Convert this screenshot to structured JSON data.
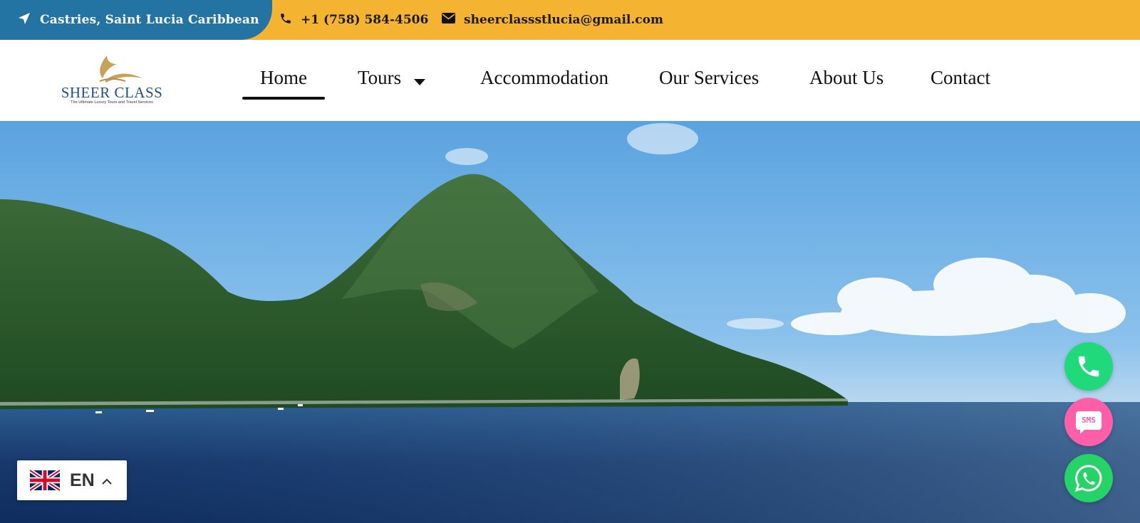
{
  "topbar": {
    "location": "Castries, Saint Lucia Caribbean",
    "phone": "+1 (758) 584-4506",
    "email": "sheerclassstlucia@gmail.com",
    "location_icon": "location-arrow-icon",
    "phone_icon": "phone-icon",
    "email_icon": "envelope-icon",
    "colors": {
      "bar": "#f4b330",
      "location_bg": "#2373a3"
    }
  },
  "logo": {
    "brand": "SHEER CLASS",
    "tagline": "The Ultimate Luxury Tours and Travel Services"
  },
  "nav": {
    "items": [
      {
        "label": "Home",
        "active": true
      },
      {
        "label": "Tours",
        "has_dropdown": true
      },
      {
        "label": "Accommodation"
      },
      {
        "label": "Our Services"
      },
      {
        "label": "About Us"
      },
      {
        "label": "Contact"
      }
    ]
  },
  "floating_buttons": {
    "phone_icon": "phone-icon",
    "sms_label": "SMS",
    "whatsapp_icon": "whatsapp-icon"
  },
  "language": {
    "code": "EN",
    "flag_icon": "uk-flag-icon",
    "chevron_icon": "chevron-up-icon"
  }
}
